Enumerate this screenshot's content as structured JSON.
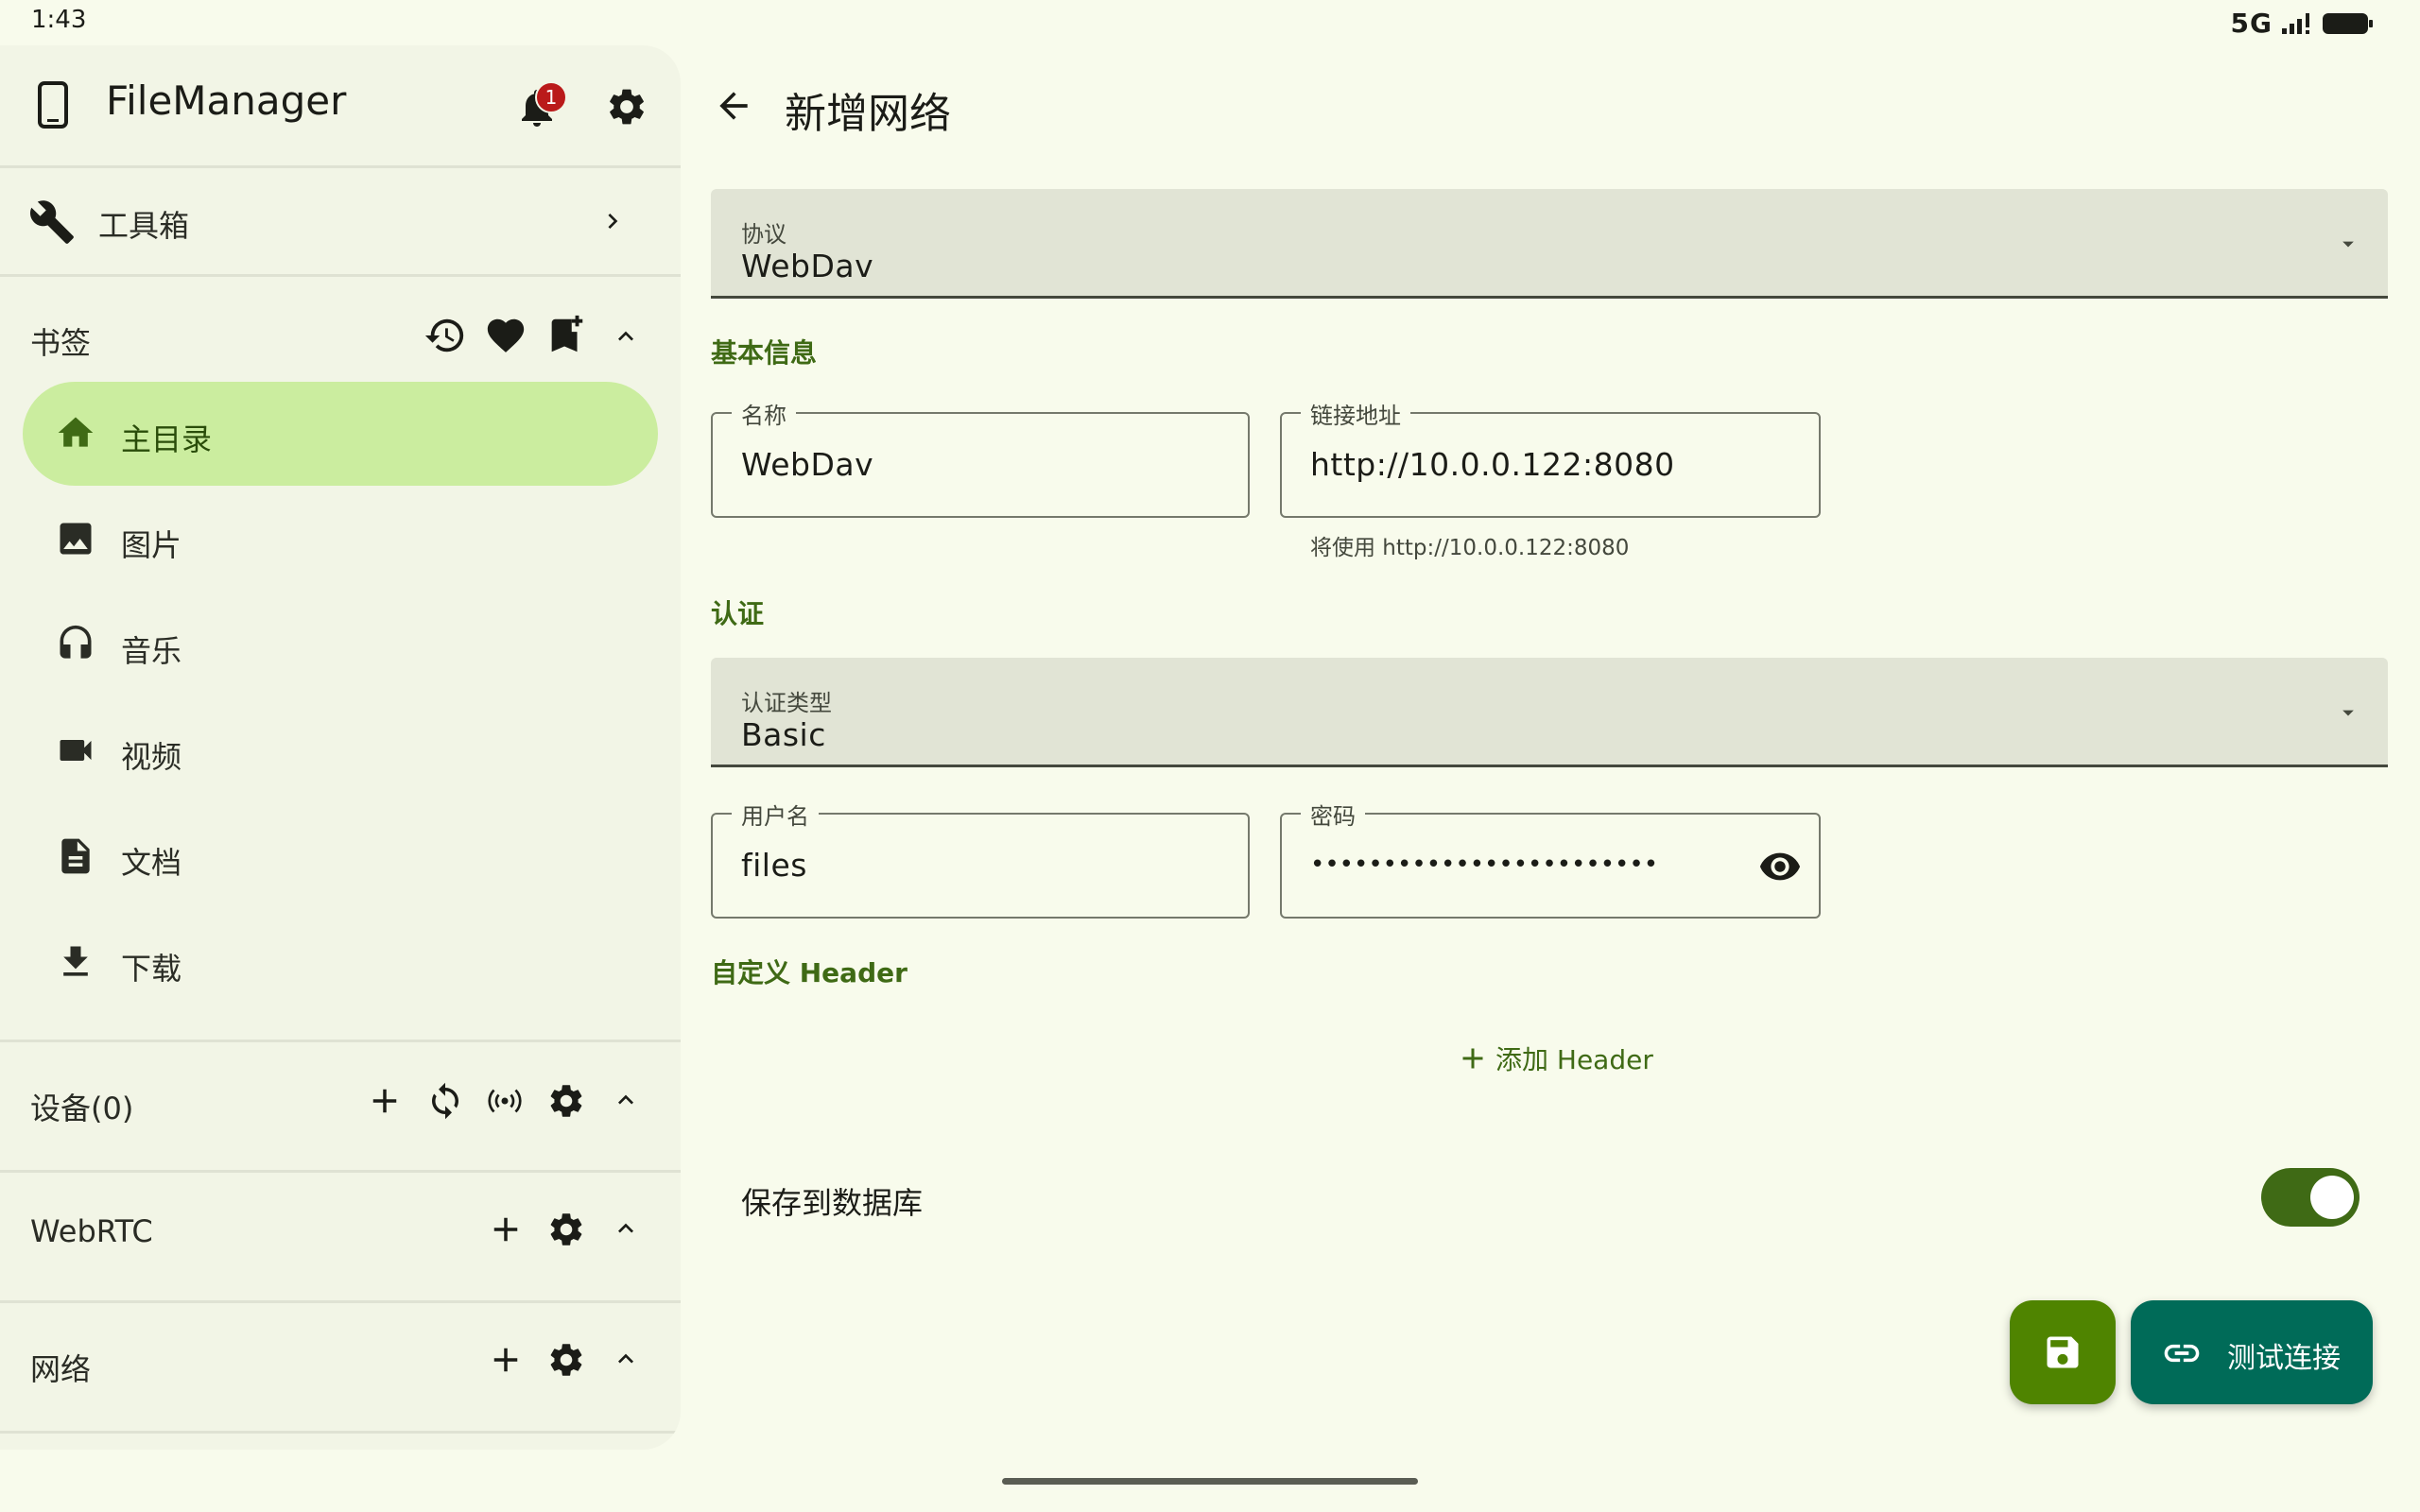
{
  "status_bar": {
    "time": "1:43",
    "network": "5G"
  },
  "drawer": {
    "app_title": "FileManager",
    "notification_count": "1",
    "toolbox_label": "工具箱",
    "bookmarks": {
      "header": "书签",
      "items": [
        {
          "label": "主目录",
          "icon": "home-icon",
          "selected": true
        },
        {
          "label": "图片",
          "icon": "image-icon"
        },
        {
          "label": "音乐",
          "icon": "headphones-icon"
        },
        {
          "label": "视频",
          "icon": "videocam-icon"
        },
        {
          "label": "文档",
          "icon": "document-icon"
        },
        {
          "label": "下载",
          "icon": "download-icon"
        }
      ]
    },
    "devices_header": "设备(0)",
    "webrtc_header": "WebRTC",
    "network_header": "网络"
  },
  "main": {
    "back_icon": "arrow-back-icon",
    "title": "新增网络",
    "protocol": {
      "label": "协议",
      "value": "WebDav"
    },
    "basic_info_title": "基本信息",
    "name_field": {
      "label": "名称",
      "value": "WebDav"
    },
    "url_field": {
      "label": "链接地址",
      "value": "http://10.0.0.122:8080",
      "helper": "将使用 http://10.0.0.122:8080"
    },
    "auth_title": "认证",
    "auth_type": {
      "label": "认证类型",
      "value": "Basic"
    },
    "username_field": {
      "label": "用户名",
      "value": "files"
    },
    "password_field": {
      "label": "密码",
      "value": "••••••••••••••••••••••••"
    },
    "custom_header_title": "自定义 Header",
    "add_header_label": "添加 Header",
    "save_to_db_label": "保存到数据库",
    "save_to_db_enabled": true,
    "test_connection_label": "测试连接"
  },
  "colors": {
    "background": "#f8fbec",
    "drawer": "#f2f5e6",
    "primary": "#3f6a15",
    "selected_pill": "#cbed9f",
    "save_fab": "#4f8400",
    "test_fab": "#006b58"
  }
}
